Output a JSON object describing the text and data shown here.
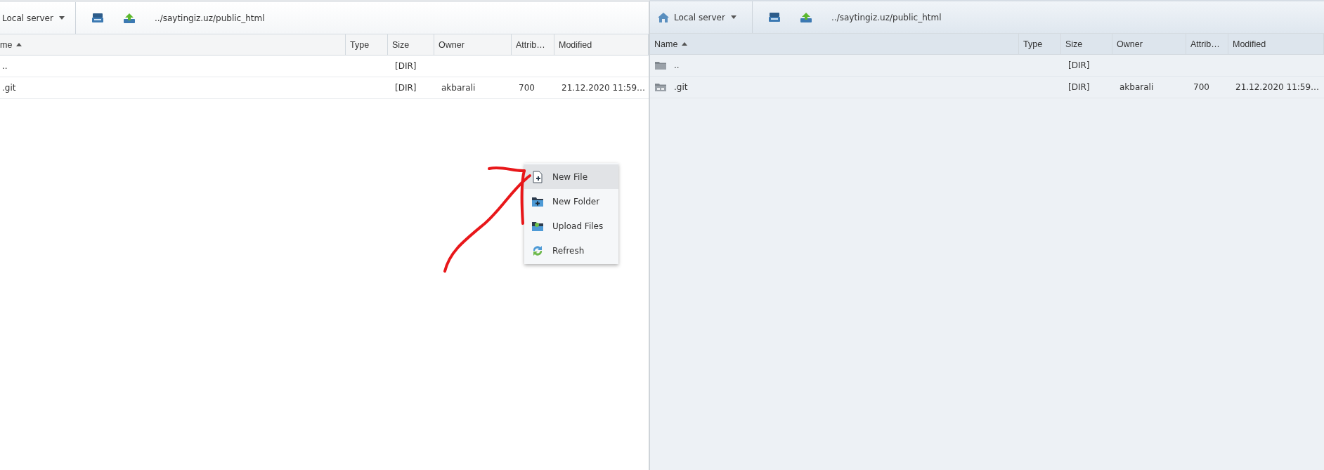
{
  "panels": [
    {
      "server": "Local server",
      "show_home_icon": false,
      "show_row_icons": false,
      "path": "../saytingiz.uz/public_html",
      "columns": [
        {
          "label": "me",
          "sorted": true
        },
        {
          "label": "Type",
          "sorted": false
        },
        {
          "label": "Size",
          "sorted": false
        },
        {
          "label": "Owner",
          "sorted": false
        },
        {
          "label": "Attrib…",
          "sorted": false
        },
        {
          "label": "Modified",
          "sorted": false
        }
      ],
      "rows": [
        {
          "name": "..",
          "size": "[DIR]"
        },
        {
          "name": ".git",
          "size": "[DIR]",
          "owner": "akbarali",
          "attrib": "700",
          "modified": "21.12.2020 11:59…"
        }
      ],
      "context_menu": [
        {
          "label": "New File",
          "selected": true
        },
        {
          "label": "New Folder",
          "selected": false
        },
        {
          "label": "Upload Files",
          "selected": false
        },
        {
          "label": "Refresh",
          "selected": false
        }
      ]
    },
    {
      "server": "Local server",
      "show_home_icon": true,
      "show_row_icons": true,
      "path": "../saytingiz.uz/public_html",
      "columns": [
        {
          "label": "Name",
          "sorted": true
        },
        {
          "label": "Type",
          "sorted": false
        },
        {
          "label": "Size",
          "sorted": false
        },
        {
          "label": "Owner",
          "sorted": false
        },
        {
          "label": "Attrib…",
          "sorted": false
        },
        {
          "label": "Modified",
          "sorted": false
        }
      ],
      "rows": [
        {
          "kind": "parent",
          "name": "..",
          "size": "[DIR]"
        },
        {
          "kind": "folder",
          "name": ".git",
          "size": "[DIR]",
          "owner": "akbarali",
          "attrib": "700",
          "modified": "21.12.2020 11:59…"
        }
      ]
    }
  ]
}
